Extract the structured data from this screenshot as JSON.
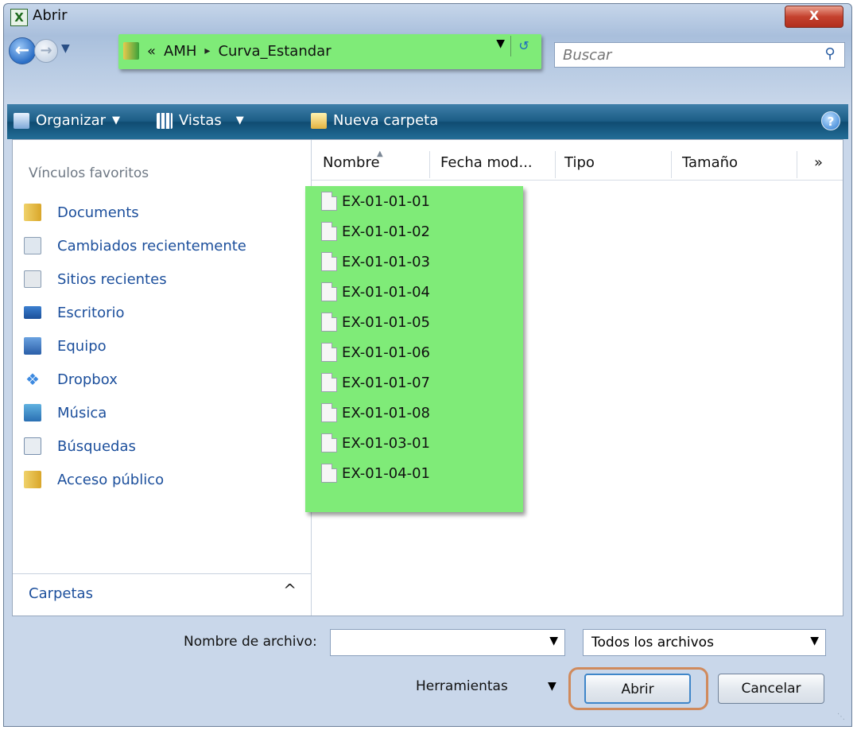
{
  "window": {
    "title": "Abrir",
    "app_icon": "X",
    "close_label": "X"
  },
  "nav": {
    "address": {
      "prefix": "«",
      "folder": "AMH",
      "separator": "▸",
      "subfolder": "Curva_Estandar"
    },
    "search": {
      "placeholder": "Buscar"
    }
  },
  "toolbar": {
    "organize": "Organizar",
    "views": "Vistas",
    "new_folder": "Nueva carpeta",
    "help": "?"
  },
  "sidebar": {
    "heading": "Vínculos favoritos",
    "items": [
      {
        "label": "Documents",
        "icon": "folder-icon"
      },
      {
        "label": "Cambiados recientemente",
        "icon": "recent-changes-icon"
      },
      {
        "label": "Sitios recientes",
        "icon": "recent-places-icon"
      },
      {
        "label": "Escritorio",
        "icon": "desktop-icon"
      },
      {
        "label": "Equipo",
        "icon": "computer-icon"
      },
      {
        "label": "Dropbox",
        "icon": "dropbox-icon"
      },
      {
        "label": "Música",
        "icon": "music-icon"
      },
      {
        "label": "Búsquedas",
        "icon": "searches-icon"
      },
      {
        "label": "Acceso público",
        "icon": "public-folder-icon"
      }
    ],
    "folders_label": "Carpetas",
    "folders_chevron": "^"
  },
  "columns": [
    "Nombre",
    "Fecha mod...",
    "Tipo",
    "Tamaño",
    "»"
  ],
  "files": [
    "EX-01-01-01",
    "EX-01-01-02",
    "EX-01-01-03",
    "EX-01-01-04",
    "EX-01-01-05",
    "EX-01-01-06",
    "EX-01-01-07",
    "EX-01-01-08",
    "EX-01-03-01",
    "EX-01-04-01"
  ],
  "footer": {
    "filename_label": "Nombre de archivo:",
    "filename_value": "",
    "filetype": "Todos los archivos",
    "tools": "Herramientas",
    "open": "Abrir",
    "cancel": "Cancelar"
  },
  "colors": {
    "highlight": "#7feb78",
    "toolbar": "#1c5d86",
    "link": "#1c4f9c",
    "ring": "#d08a5c"
  }
}
